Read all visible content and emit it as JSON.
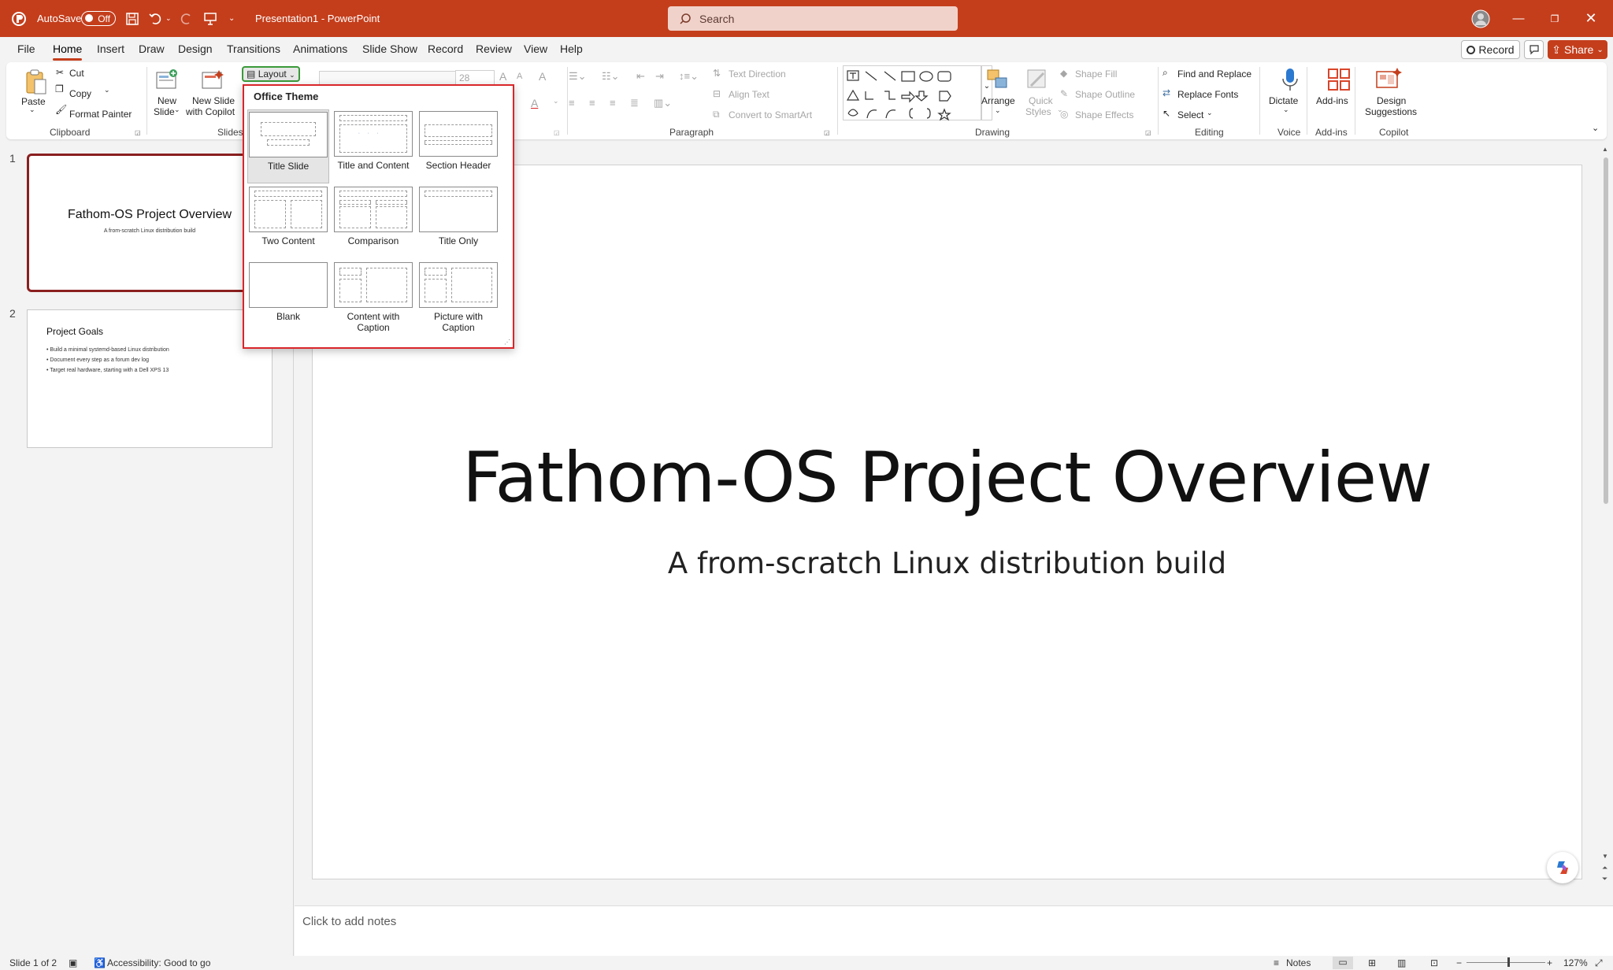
{
  "titlebar": {
    "autosave_label": "AutoSave",
    "autosave_state": "Off",
    "doc_title": "Presentation1  -  PowerPoint",
    "search_placeholder": "Search",
    "accent": "#c43e1c"
  },
  "menu": {
    "tabs": [
      "File",
      "Home",
      "Insert",
      "Draw",
      "Design",
      "Transitions",
      "Animations",
      "Slide Show",
      "Record",
      "Review",
      "View",
      "Help"
    ],
    "active_tab": "Home",
    "record_label": "Record",
    "share_label": "Share"
  },
  "ribbon": {
    "clipboard": {
      "paste": "Paste",
      "cut": "Cut",
      "copy": "Copy",
      "format_painter": "Format Painter",
      "group": "Clipboard"
    },
    "slides": {
      "new_slide_1": "New",
      "new_slide_2": "Slide",
      "new_copilot_1": "New Slide",
      "new_copilot_2": "with Copilot",
      "layout": "Layout",
      "group": "Slides"
    },
    "font": {
      "size": "28"
    },
    "paragraph": {
      "text_direction": "Text Direction",
      "align_text": "Align Text",
      "convert_smartart": "Convert to SmartArt",
      "group": "Paragraph"
    },
    "drawing": {
      "arrange": "Arrange",
      "quick_styles_1": "Quick",
      "quick_styles_2": "Styles",
      "shape_fill": "Shape Fill",
      "shape_outline": "Shape Outline",
      "shape_effects": "Shape Effects",
      "group": "Drawing"
    },
    "editing": {
      "find_replace": "Find and Replace",
      "replace_fonts": "Replace Fonts",
      "select": "Select",
      "group": "Editing"
    },
    "voice": {
      "dictate": "Dictate",
      "group": "Voice"
    },
    "addins": {
      "addins": "Add-ins",
      "group": "Add-ins"
    },
    "copilot": {
      "design_1": "Design",
      "design_2": "Suggestions",
      "group": "Copilot"
    }
  },
  "layout_menu": {
    "header": "Office Theme",
    "layouts": [
      {
        "name": "Title Slide"
      },
      {
        "name": "Title and Content"
      },
      {
        "name": "Section Header"
      },
      {
        "name": "Two Content"
      },
      {
        "name": "Comparison"
      },
      {
        "name": "Title Only"
      },
      {
        "name": "Blank"
      },
      {
        "name": "Content with Caption"
      },
      {
        "name": "Picture with Caption"
      }
    ],
    "selected": "Title Slide"
  },
  "thumbnails": [
    {
      "number": "1",
      "title": "Fathom-OS Project Overview",
      "subtitle": "A from-scratch Linux distribution build"
    },
    {
      "number": "2",
      "title": "Project Goals",
      "bullets": [
        "• Build a minimal systemd-based Linux distribution",
        "• Document every step as a forum dev log",
        "• Target real hardware, starting with a Dell XPS 13"
      ]
    }
  ],
  "slide": {
    "title": "Fathom-OS Project Overview",
    "subtitle": "A from-scratch Linux distribution build"
  },
  "notes": {
    "placeholder": "Click to add notes"
  },
  "status": {
    "slide_info": "Slide 1 of 2",
    "accessibility": "Accessibility: Good to go",
    "notes_label": "Notes",
    "zoom": "127%"
  }
}
